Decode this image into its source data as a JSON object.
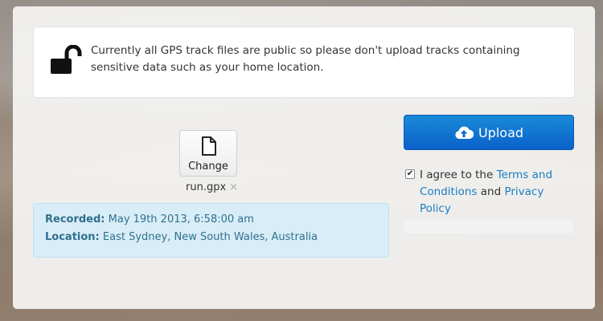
{
  "notice": {
    "text": "Currently all GPS track files are public so please don't upload tracks containing sensitive data such as your home location.",
    "icon": "unlock-icon"
  },
  "file": {
    "change_label": "Change",
    "filename": "run.gpx",
    "remove_symbol": "×",
    "icon": "file-icon"
  },
  "info": {
    "recorded_label": "Recorded:",
    "recorded_value": "May 19th 2013, 6:58:00 am",
    "location_label": "Location:",
    "location_value": "East Sydney, New South Wales, Australia"
  },
  "upload": {
    "label": "Upload",
    "icon": "cloud-upload-icon",
    "color": "#0a6fd0"
  },
  "agreement": {
    "checked": true,
    "checkmark": "✔",
    "prefix": "I agree to the",
    "terms_link": "Terms and Conditions",
    "conjunction": "and",
    "privacy_link": "Privacy Policy"
  },
  "progress": {
    "value": 0
  }
}
